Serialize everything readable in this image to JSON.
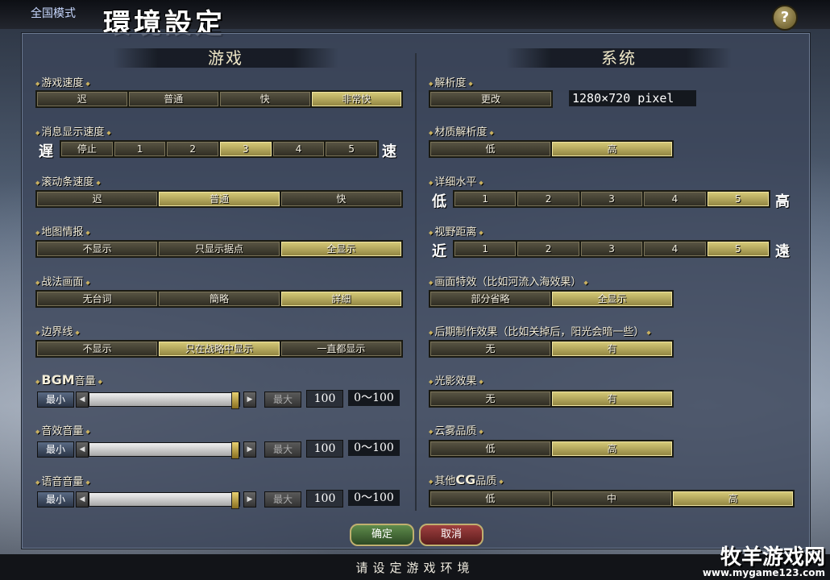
{
  "header": {
    "mode": "全国模式",
    "title": "環境設定",
    "help": "?"
  },
  "left": {
    "title": "游戏",
    "game_speed": {
      "label": "游戏速度",
      "options": [
        "迟",
        "普通",
        "快",
        "非常快"
      ],
      "selected": 3
    },
    "msg_speed": {
      "label": "消息显示速度",
      "slow": "遅",
      "fast": "速",
      "options": [
        "停止",
        "1",
        "2",
        "3",
        "4",
        "5"
      ],
      "selected": 3
    },
    "scroll_speed": {
      "label": "滚动条速度",
      "options": [
        "迟",
        "普通",
        "快"
      ],
      "selected": 1
    },
    "map_info": {
      "label": "地图情报",
      "options": [
        "不显示",
        "只显示据点",
        "全显示"
      ],
      "selected": 2
    },
    "battle_screen": {
      "label": "战法画面",
      "options": [
        "无台词",
        "簡略",
        "詳細"
      ],
      "selected": 2
    },
    "border": {
      "label": "边界线",
      "options": [
        "不显示",
        "只在战略中显示",
        "一直都显示"
      ],
      "selected": 1
    },
    "bgm": {
      "label_bold": "BGM",
      "label_rest": "音量",
      "min": "最小",
      "max": "最大",
      "value": "100",
      "range": "0～100",
      "level": 1.0
    },
    "sfx": {
      "label": "音效音量",
      "min": "最小",
      "max": "最大",
      "value": "100",
      "range": "0～100",
      "level": 1.0
    },
    "voice": {
      "label": "语音音量",
      "min": "最小",
      "max": "最大",
      "value": "100",
      "range": "0～100",
      "level": 1.0
    }
  },
  "right": {
    "title": "系统",
    "resolution": {
      "label": "解析度",
      "button": "更改",
      "value": "1280×720 pixel"
    },
    "texture": {
      "label": "材质解析度",
      "options": [
        "低",
        "高"
      ],
      "selected": 1
    },
    "detail": {
      "label": "详细水平",
      "low": "低",
      "high": "高",
      "options": [
        "1",
        "2",
        "3",
        "4",
        "5"
      ],
      "selected": 4
    },
    "view_distance": {
      "label": "视野距离",
      "near": "近",
      "far": "遠",
      "options": [
        "1",
        "2",
        "3",
        "4",
        "5"
      ],
      "selected": 4
    },
    "effects": {
      "label": "画面特效（比如河流入海效果）",
      "options": [
        "部分省略",
        "全显示"
      ],
      "selected": 1
    },
    "post": {
      "label": "后期制作效果（比如关掉后，阳光会暗一些）",
      "options": [
        "无",
        "有"
      ],
      "selected": 1
    },
    "light": {
      "label": "光影效果",
      "options": [
        "无",
        "有"
      ],
      "selected": 1
    },
    "fog": {
      "label": "云雾品质",
      "options": [
        "低",
        "高"
      ],
      "selected": 1
    },
    "cg": {
      "label_pre": "其他",
      "label_bold": "CG",
      "label_post": "品质",
      "options": [
        "低",
        "中",
        "高"
      ],
      "selected": 2
    }
  },
  "footer": {
    "ok": "确定",
    "cancel": "取消",
    "status": "请设定游戏环境"
  },
  "watermark": {
    "line1": "牧羊游戏网",
    "line2": "www.mygame123.com"
  }
}
